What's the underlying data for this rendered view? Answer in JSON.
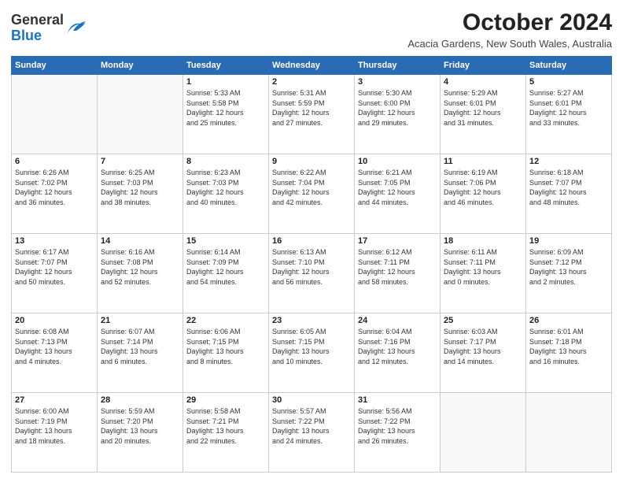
{
  "logo": {
    "general": "General",
    "blue": "Blue"
  },
  "title": "October 2024",
  "subtitle": "Acacia Gardens, New South Wales, Australia",
  "days_header": [
    "Sunday",
    "Monday",
    "Tuesday",
    "Wednesday",
    "Thursday",
    "Friday",
    "Saturday"
  ],
  "weeks": [
    [
      {
        "day": "",
        "info": ""
      },
      {
        "day": "",
        "info": ""
      },
      {
        "day": "1",
        "info": "Sunrise: 5:33 AM\nSunset: 5:58 PM\nDaylight: 12 hours\nand 25 minutes."
      },
      {
        "day": "2",
        "info": "Sunrise: 5:31 AM\nSunset: 5:59 PM\nDaylight: 12 hours\nand 27 minutes."
      },
      {
        "day": "3",
        "info": "Sunrise: 5:30 AM\nSunset: 6:00 PM\nDaylight: 12 hours\nand 29 minutes."
      },
      {
        "day": "4",
        "info": "Sunrise: 5:29 AM\nSunset: 6:01 PM\nDaylight: 12 hours\nand 31 minutes."
      },
      {
        "day": "5",
        "info": "Sunrise: 5:27 AM\nSunset: 6:01 PM\nDaylight: 12 hours\nand 33 minutes."
      }
    ],
    [
      {
        "day": "6",
        "info": "Sunrise: 6:26 AM\nSunset: 7:02 PM\nDaylight: 12 hours\nand 36 minutes."
      },
      {
        "day": "7",
        "info": "Sunrise: 6:25 AM\nSunset: 7:03 PM\nDaylight: 12 hours\nand 38 minutes."
      },
      {
        "day": "8",
        "info": "Sunrise: 6:23 AM\nSunset: 7:03 PM\nDaylight: 12 hours\nand 40 minutes."
      },
      {
        "day": "9",
        "info": "Sunrise: 6:22 AM\nSunset: 7:04 PM\nDaylight: 12 hours\nand 42 minutes."
      },
      {
        "day": "10",
        "info": "Sunrise: 6:21 AM\nSunset: 7:05 PM\nDaylight: 12 hours\nand 44 minutes."
      },
      {
        "day": "11",
        "info": "Sunrise: 6:19 AM\nSunset: 7:06 PM\nDaylight: 12 hours\nand 46 minutes."
      },
      {
        "day": "12",
        "info": "Sunrise: 6:18 AM\nSunset: 7:07 PM\nDaylight: 12 hours\nand 48 minutes."
      }
    ],
    [
      {
        "day": "13",
        "info": "Sunrise: 6:17 AM\nSunset: 7:07 PM\nDaylight: 12 hours\nand 50 minutes."
      },
      {
        "day": "14",
        "info": "Sunrise: 6:16 AM\nSunset: 7:08 PM\nDaylight: 12 hours\nand 52 minutes."
      },
      {
        "day": "15",
        "info": "Sunrise: 6:14 AM\nSunset: 7:09 PM\nDaylight: 12 hours\nand 54 minutes."
      },
      {
        "day": "16",
        "info": "Sunrise: 6:13 AM\nSunset: 7:10 PM\nDaylight: 12 hours\nand 56 minutes."
      },
      {
        "day": "17",
        "info": "Sunrise: 6:12 AM\nSunset: 7:11 PM\nDaylight: 12 hours\nand 58 minutes."
      },
      {
        "day": "18",
        "info": "Sunrise: 6:11 AM\nSunset: 7:11 PM\nDaylight: 13 hours\nand 0 minutes."
      },
      {
        "day": "19",
        "info": "Sunrise: 6:09 AM\nSunset: 7:12 PM\nDaylight: 13 hours\nand 2 minutes."
      }
    ],
    [
      {
        "day": "20",
        "info": "Sunrise: 6:08 AM\nSunset: 7:13 PM\nDaylight: 13 hours\nand 4 minutes."
      },
      {
        "day": "21",
        "info": "Sunrise: 6:07 AM\nSunset: 7:14 PM\nDaylight: 13 hours\nand 6 minutes."
      },
      {
        "day": "22",
        "info": "Sunrise: 6:06 AM\nSunset: 7:15 PM\nDaylight: 13 hours\nand 8 minutes."
      },
      {
        "day": "23",
        "info": "Sunrise: 6:05 AM\nSunset: 7:15 PM\nDaylight: 13 hours\nand 10 minutes."
      },
      {
        "day": "24",
        "info": "Sunrise: 6:04 AM\nSunset: 7:16 PM\nDaylight: 13 hours\nand 12 minutes."
      },
      {
        "day": "25",
        "info": "Sunrise: 6:03 AM\nSunset: 7:17 PM\nDaylight: 13 hours\nand 14 minutes."
      },
      {
        "day": "26",
        "info": "Sunrise: 6:01 AM\nSunset: 7:18 PM\nDaylight: 13 hours\nand 16 minutes."
      }
    ],
    [
      {
        "day": "27",
        "info": "Sunrise: 6:00 AM\nSunset: 7:19 PM\nDaylight: 13 hours\nand 18 minutes."
      },
      {
        "day": "28",
        "info": "Sunrise: 5:59 AM\nSunset: 7:20 PM\nDaylight: 13 hours\nand 20 minutes."
      },
      {
        "day": "29",
        "info": "Sunrise: 5:58 AM\nSunset: 7:21 PM\nDaylight: 13 hours\nand 22 minutes."
      },
      {
        "day": "30",
        "info": "Sunrise: 5:57 AM\nSunset: 7:22 PM\nDaylight: 13 hours\nand 24 minutes."
      },
      {
        "day": "31",
        "info": "Sunrise: 5:56 AM\nSunset: 7:22 PM\nDaylight: 13 hours\nand 26 minutes."
      },
      {
        "day": "",
        "info": ""
      },
      {
        "day": "",
        "info": ""
      }
    ]
  ]
}
